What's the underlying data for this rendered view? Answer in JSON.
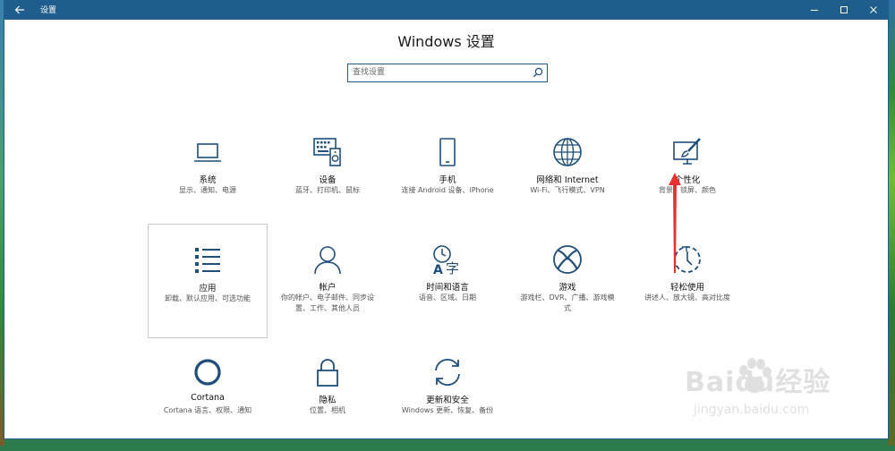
{
  "titlebar": {
    "title": "设置"
  },
  "page": {
    "heading": "Windows 设置"
  },
  "search": {
    "placeholder": "查找设置"
  },
  "tiles": [
    {
      "name": "系统",
      "desc": "显示、通知、电源",
      "icon": "laptop-icon"
    },
    {
      "name": "设备",
      "desc": "蓝牙、打印机、鼠标",
      "icon": "devices-icon"
    },
    {
      "name": "手机",
      "desc": "连接 Android 设备、iPhone",
      "icon": "phone-icon"
    },
    {
      "name": "网络和 Internet",
      "desc": "Wi-Fi、飞行模式、VPN",
      "icon": "globe-icon"
    },
    {
      "name": "个性化",
      "desc": "背景、锁屏、颜色",
      "icon": "personalization-icon"
    },
    {
      "name": "应用",
      "desc": "卸载、默认应用、可选功能",
      "icon": "apps-list-icon"
    },
    {
      "name": "帐户",
      "desc": "你的帐户、电子邮件、同步设置、工作、其他人员",
      "icon": "person-icon"
    },
    {
      "name": "时间和语言",
      "desc": "语音、区域、日期",
      "icon": "time-language-icon"
    },
    {
      "name": "游戏",
      "desc": "游戏栏、DVR、广播、游戏模式",
      "icon": "xbox-icon"
    },
    {
      "name": "轻松使用",
      "desc": "讲述人、放大镜、高对比度",
      "icon": "ease-of-access-icon"
    },
    {
      "name": "Cortana",
      "desc": "Cortana 语言、权限、通知",
      "icon": "cortana-icon"
    },
    {
      "name": "隐私",
      "desc": "位置、相机",
      "icon": "lock-icon"
    },
    {
      "name": "更新和安全",
      "desc": "Windows 更新、恢复、备份",
      "icon": "update-icon"
    }
  ],
  "watermark": {
    "text": "Baidu经验",
    "url": "jingyan.baidu.com"
  },
  "colors": {
    "titlebar": "#1e5d8c",
    "icon": "#1e4e79",
    "arrow": "#e5312f"
  }
}
